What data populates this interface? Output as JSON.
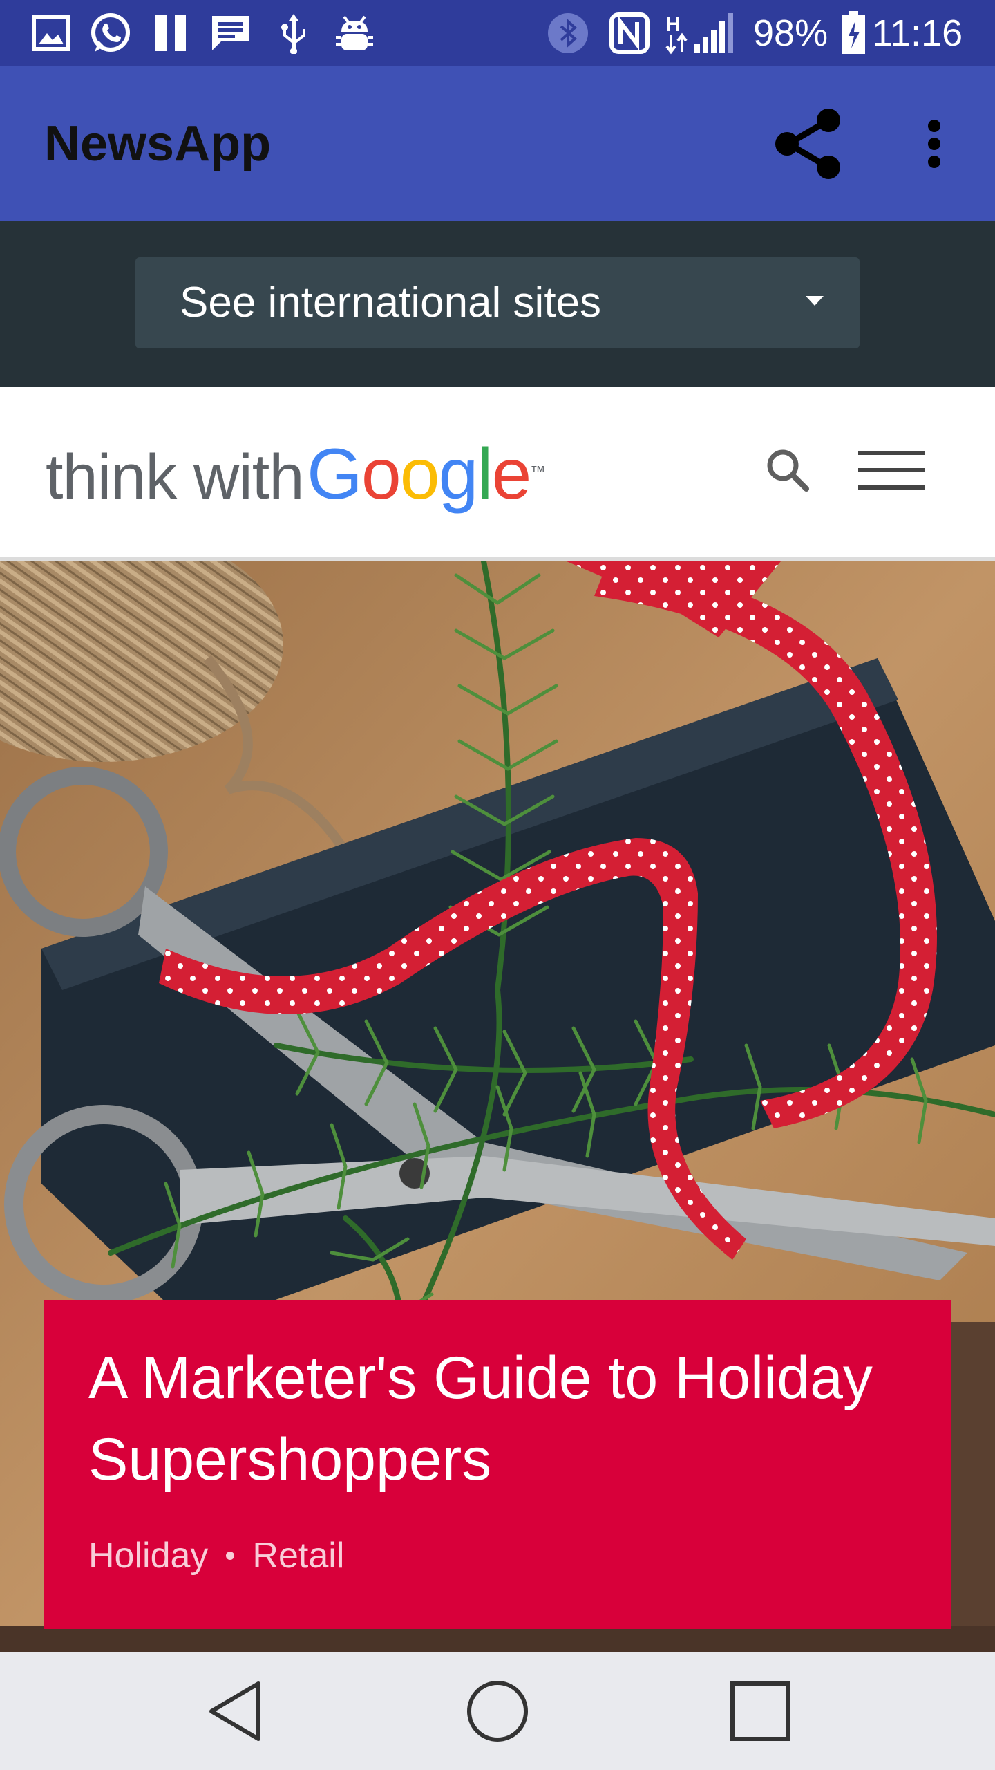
{
  "status_bar": {
    "battery_percent": "98%",
    "time": "11:16",
    "icons": [
      "gallery-icon",
      "whatsapp-icon",
      "pause-icon",
      "message-icon",
      "usb-icon",
      "android-debug-icon",
      "bluetooth-icon",
      "nfc-icon",
      "data-h-icon",
      "signal-icon",
      "battery-icon"
    ]
  },
  "app_bar": {
    "title": "NewsApp",
    "actions": [
      "share-icon",
      "overflow-menu-icon"
    ],
    "background": "#3f51b5"
  },
  "intl_banner": {
    "select_value": "See international sites",
    "background": "#263238"
  },
  "site_header": {
    "logo_prefix": "think with",
    "logo_letters": [
      "G",
      "o",
      "o",
      "g",
      "l",
      "e"
    ],
    "logo_colors": [
      "#4285f4",
      "#ea4335",
      "#fbbc05",
      "#4285f4",
      "#34a853",
      "#ea4335"
    ],
    "logo_tm": "™",
    "actions": [
      "search-icon",
      "hamburger-menu-icon"
    ]
  },
  "hero": {
    "title": "A Marketer's Guide to Holiday Supershoppers",
    "tags": [
      "Holiday",
      "Retail"
    ],
    "card_color": "#d8003a"
  },
  "nav_bar": {
    "buttons": [
      "back-icon",
      "home-icon",
      "recents-icon"
    ]
  }
}
